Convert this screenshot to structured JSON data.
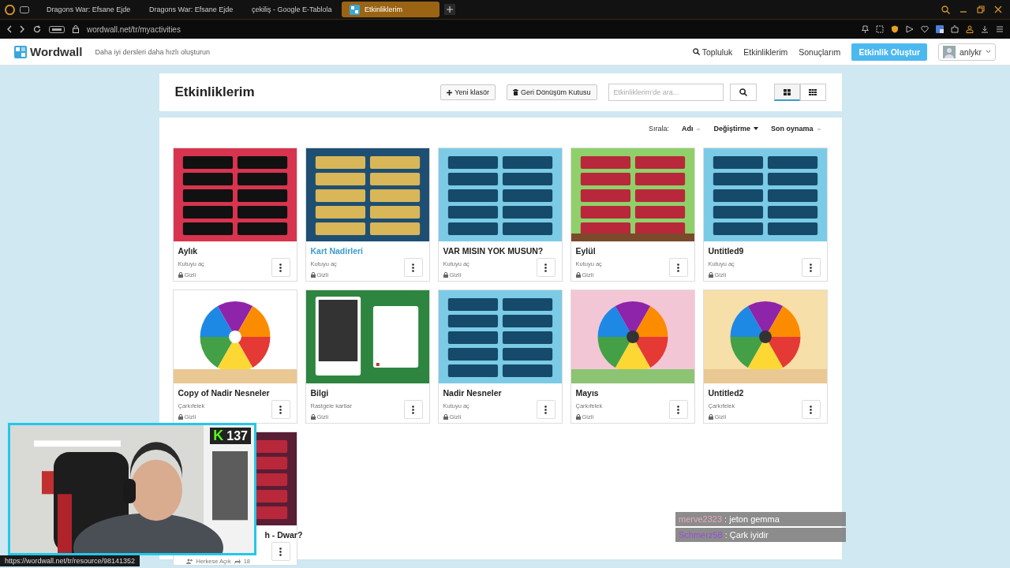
{
  "browser": {
    "tabs": [
      {
        "title": "Dragons War: Efsane Ejde",
        "kind": "game",
        "selected": false
      },
      {
        "title": "Dragons War: Efsane Ejde",
        "kind": "game",
        "selected": false
      },
      {
        "title": "çekiliş - Google E-Tablola",
        "kind": "sheet",
        "selected": false
      },
      {
        "title": "Etkinliklerim",
        "kind": "wordwall",
        "selected": true
      }
    ],
    "address": "wordwall.net/tr/myactivities"
  },
  "header": {
    "logo": "Wordwall",
    "tagline": "Daha iyi dersleri daha hızlı oluşturun",
    "nav": [
      {
        "label": "Topluluk",
        "kind": "search"
      },
      {
        "label": "Etkinliklerim",
        "kind": "plain"
      },
      {
        "label": "Sonuçlarım",
        "kind": "plain"
      }
    ],
    "create_button": "Etkinlik Oluştur",
    "user": "anlykr"
  },
  "page": {
    "title": "Etkinliklerim",
    "buttons": [
      {
        "label": "Yeni klasör",
        "kind": "plus"
      },
      {
        "label": "Geri Dönüşüm Kutusu",
        "kind": "trash"
      }
    ],
    "search": {
      "placeholder": "Etkinliklerim'de ara..."
    },
    "views": [
      {
        "kind": "large",
        "selected": true
      },
      {
        "kind": "small",
        "selected": false
      }
    ],
    "sort": {
      "label": "Sırala:",
      "options": [
        {
          "label": "Adı",
          "selected": false
        },
        {
          "label": "Değiştirme",
          "selected": true
        },
        {
          "label": "Son oynama",
          "selected": false
        }
      ]
    }
  },
  "cards": [
    {
      "title": "Aylık",
      "type": "Kutuyu aç",
      "visibility": "Gizli",
      "highlighted": false
    },
    {
      "title": "Kart Nadirleri",
      "type": "Kutuyu aç",
      "visibility": "Gizli",
      "highlighted": true
    },
    {
      "title": "VAR MISIN YOK MUSUN?",
      "type": "Kutuyu aç",
      "visibility": "Gizli",
      "highlighted": false
    },
    {
      "title": "Eylül",
      "type": "Kutuyu aç",
      "visibility": "Gizli",
      "highlighted": false
    },
    {
      "title": "Untitled9",
      "type": "Kutuyu aç",
      "visibility": "Gizli",
      "highlighted": false
    },
    {
      "title": "Copy of Nadir Nesneler",
      "type": "Çarkıfelek",
      "visibility": "Gizli",
      "highlighted": false
    },
    {
      "title": "Bilgi",
      "type": "Rastgele kartlar",
      "visibility": "Gizli",
      "highlighted": false
    },
    {
      "title": "Nadir Nesneler",
      "type": "Kutuyu aç",
      "visibility": "Gizli",
      "highlighted": false
    },
    {
      "title": "Mayıs",
      "type": "Çarkıfelek",
      "visibility": "Gizli",
      "highlighted": false
    },
    {
      "title": "Untitled2",
      "type": "Çarkıfelek",
      "visibility": "Gizli",
      "highlighted": false
    },
    {
      "title": "h - Dwar?",
      "visibility": "Herkese Açık",
      "count": "18",
      "highlighted": false
    }
  ],
  "webcam": {
    "badge_logo": "K",
    "badge_count": "137"
  },
  "status_url": "https://wordwall.net/tr/resource/98141352",
  "chat": [
    {
      "user": "merve2323",
      "color": "#e3a9bb",
      "message": ": jeton gemma"
    },
    {
      "user": "Schmerz58",
      "color": "#9a4fd8",
      "message": ": Çark iyidir"
    }
  ]
}
